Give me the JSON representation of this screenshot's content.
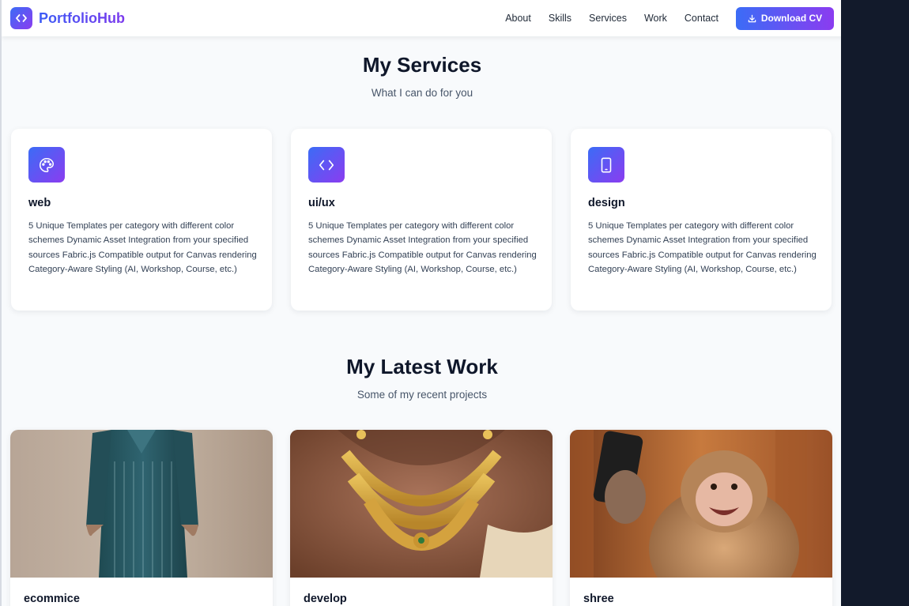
{
  "brand": {
    "name": "PortfolioHub",
    "icon": "code-icon"
  },
  "nav": {
    "links": [
      "About",
      "Skills",
      "Services",
      "Work",
      "Contact"
    ],
    "cta_label": "Download CV",
    "cta_icon": "download-icon"
  },
  "services": {
    "title": "My Services",
    "subtitle": "What I can do for you",
    "cards": [
      {
        "icon": "palette-icon",
        "title": "web",
        "description": "5 Unique Templates per category with different color schemes Dynamic Asset Integration from your specified sources Fabric.js Compatible output for Canvas rendering Category-Aware Styling (AI, Workshop, Course, etc.)"
      },
      {
        "icon": "code-icon",
        "title": "ui/ux",
        "description": "5 Unique Templates per category with different color schemes Dynamic Asset Integration from your specified sources Fabric.js Compatible output for Canvas rendering Category-Aware Styling (AI, Workshop, Course, etc.)"
      },
      {
        "icon": "tablet-icon",
        "title": "design",
        "description": "5 Unique Templates per category with different color schemes Dynamic Asset Integration from your specified sources Fabric.js Compatible output for Canvas rendering Category-Aware Styling (AI, Workshop, Course, etc.)"
      }
    ]
  },
  "work": {
    "title": "My Latest Work",
    "subtitle": "Some of my recent projects",
    "projects": [
      {
        "title": "ecommice",
        "image": "teal-kurta-photo"
      },
      {
        "title": "develop",
        "image": "gold-necklace-photo"
      },
      {
        "title": "shree",
        "image": "monkey-selfie-photo"
      }
    ]
  },
  "colors": {
    "accent_start": "#3b6cf6",
    "accent_end": "#8b3cf0",
    "page_bg": "#f8fafc",
    "outer_bg": "#121a2b"
  }
}
